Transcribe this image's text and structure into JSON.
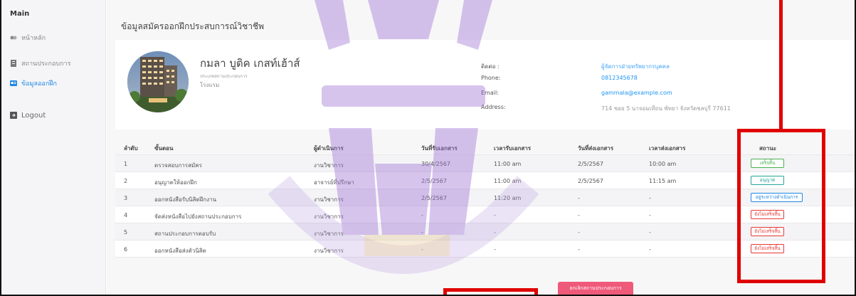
{
  "sidebar": {
    "header": "Main",
    "items": [
      {
        "label": "หน้าหลัก",
        "icon": "dashboard-icon"
      },
      {
        "label": "สถานประกอบการ",
        "icon": "building-icon"
      },
      {
        "label": "ข้อมูลออกฝึก",
        "icon": "id-card-icon"
      }
    ],
    "logout": "Logout"
  },
  "page": {
    "title": "ข้อมูลสมัครออกฝึกประสบการณ์วิชาชีพ"
  },
  "profile": {
    "name": "กมลา บูติค เกสท์เฮ้าส์",
    "subtitle": "ประเภทสถานประกอบการ",
    "type": "โรงแรม",
    "contact_label": "ติดต่อ :",
    "contact_value": "ผู้จัดการฝ่ายทรัพยากรบุคคล",
    "phone_label": "Phone:",
    "phone_value": "0812345678",
    "email_label": "Email:",
    "email_value": "gammala@example.com",
    "address_label": "Address:",
    "address_value": "714 ซอย 5 นาจอมเทียน พัทยา จังหวัดชลบุรี 77611"
  },
  "table": {
    "headers": [
      "ลำดับ",
      "ขั้นตอน",
      "ผู้ดำเนินการ",
      "วันที่รับเอกสาร",
      "เวลารับเอกสาร",
      "วันที่ส่งเอกสาร",
      "เวลาส่งเอกสาร",
      "สถานะ"
    ],
    "rows": [
      {
        "no": "1",
        "step": "ตรวจสอบการสมัคร",
        "by": "งานวิชาการ",
        "recv_date": "30/4/2567",
        "recv_time": "11:00 am",
        "send_date": "2/5/2567",
        "send_time": "10:00 am",
        "status": "เสร็จสิ้น",
        "status_type": "done"
      },
      {
        "no": "2",
        "step": "อนุญาตให้ออกฝึก",
        "by": "อาจารย์ที่ปรึกษา",
        "recv_date": "2/5/2567",
        "recv_time": "11:00 am",
        "send_date": "2/5/2567",
        "send_time": "11:15 am",
        "status": "อนุญาต",
        "status_type": "approved"
      },
      {
        "no": "3",
        "step": "ออกหนังสือรับนิสิตฝึกงาน",
        "by": "งานวิชาการ",
        "recv_date": "2/5/2567",
        "recv_time": "11:20 am",
        "send_date": "-",
        "send_time": "-",
        "status": "อยู่ระหว่างดำเนินการ",
        "status_type": "progress"
      },
      {
        "no": "4",
        "step": "จัดส่งหนังสือไปยังสถานประกอบการ",
        "by": "งานวิชาการ",
        "recv_date": "-",
        "recv_time": "-",
        "send_date": "-",
        "send_time": "-",
        "status": "ยังไม่เสร็จสิ้น",
        "status_type": "pending"
      },
      {
        "no": "5",
        "step": "สถานประกอบการตอบรับ",
        "by": "งานวิชาการ",
        "recv_date": "-",
        "recv_time": "-",
        "send_date": "-",
        "send_time": "-",
        "status": "ยังไม่เสร็จสิ้น",
        "status_type": "pending"
      },
      {
        "no": "6",
        "step": "ออกหนังสือส่งตัวนิสิต",
        "by": "งานวิชาการ",
        "recv_date": "-",
        "recv_time": "-",
        "send_date": "-",
        "send_time": "-",
        "status": "ยังไม่เสร็จสิ้น",
        "status_type": "pending"
      }
    ]
  },
  "actions": {
    "cancel_label": "ยกเลิกสถานประกอบการ"
  },
  "colors": {
    "annotation": "#e00000",
    "link": "#2196f3",
    "cancel_button": "#ef5a7a",
    "watermark": "#8a5cc4"
  }
}
